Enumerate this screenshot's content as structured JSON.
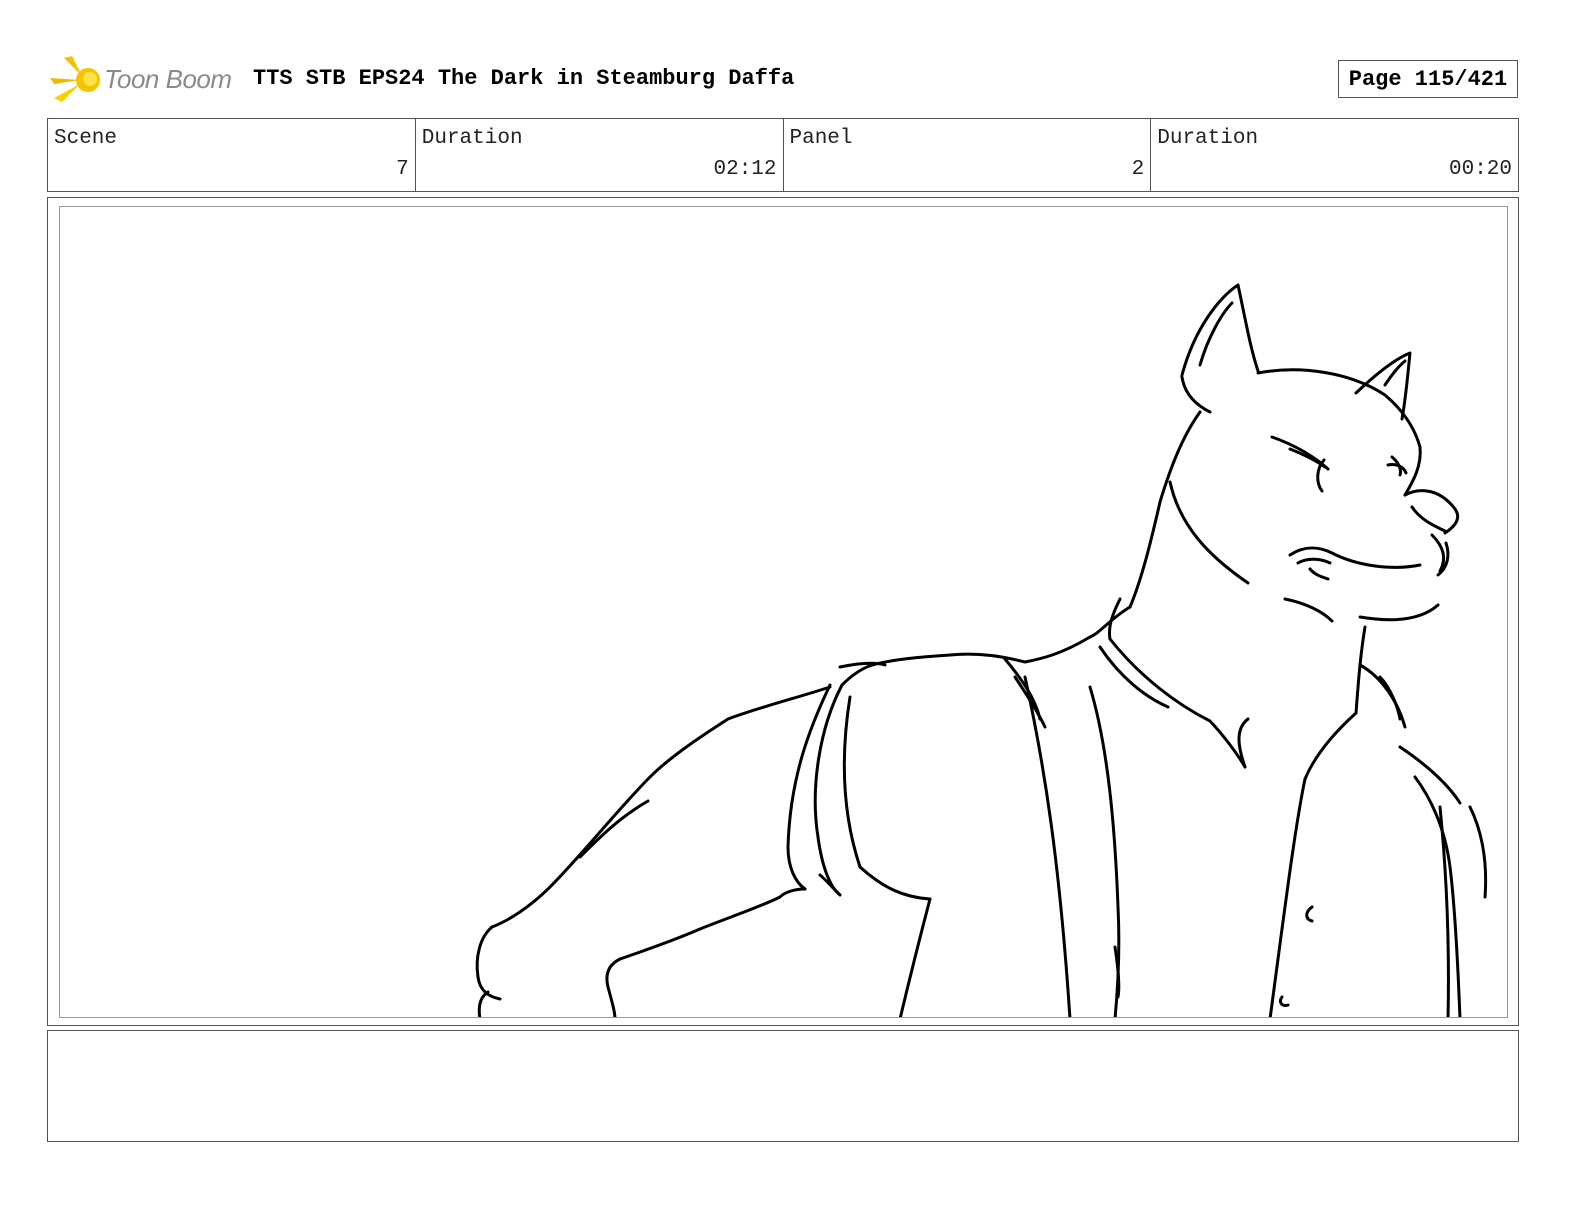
{
  "header": {
    "logo_text": "Toon Boom",
    "title": "TTS STB EPS24 The Dark in Steamburg Daffa",
    "page": "Page 115/421"
  },
  "info": {
    "scene_label": "Scene",
    "scene_value": "7",
    "scene_duration_label": "Duration",
    "scene_duration_value": "02:12",
    "panel_label": "Panel",
    "panel_value": "2",
    "panel_duration_label": "Duration",
    "panel_duration_value": "00:20"
  },
  "panel": {
    "image_icon": "sketch-dog-character-icon"
  },
  "colors": {
    "logo_accent": "#f5c400",
    "logo_text": "#8a8a8a",
    "border": "#555555"
  }
}
